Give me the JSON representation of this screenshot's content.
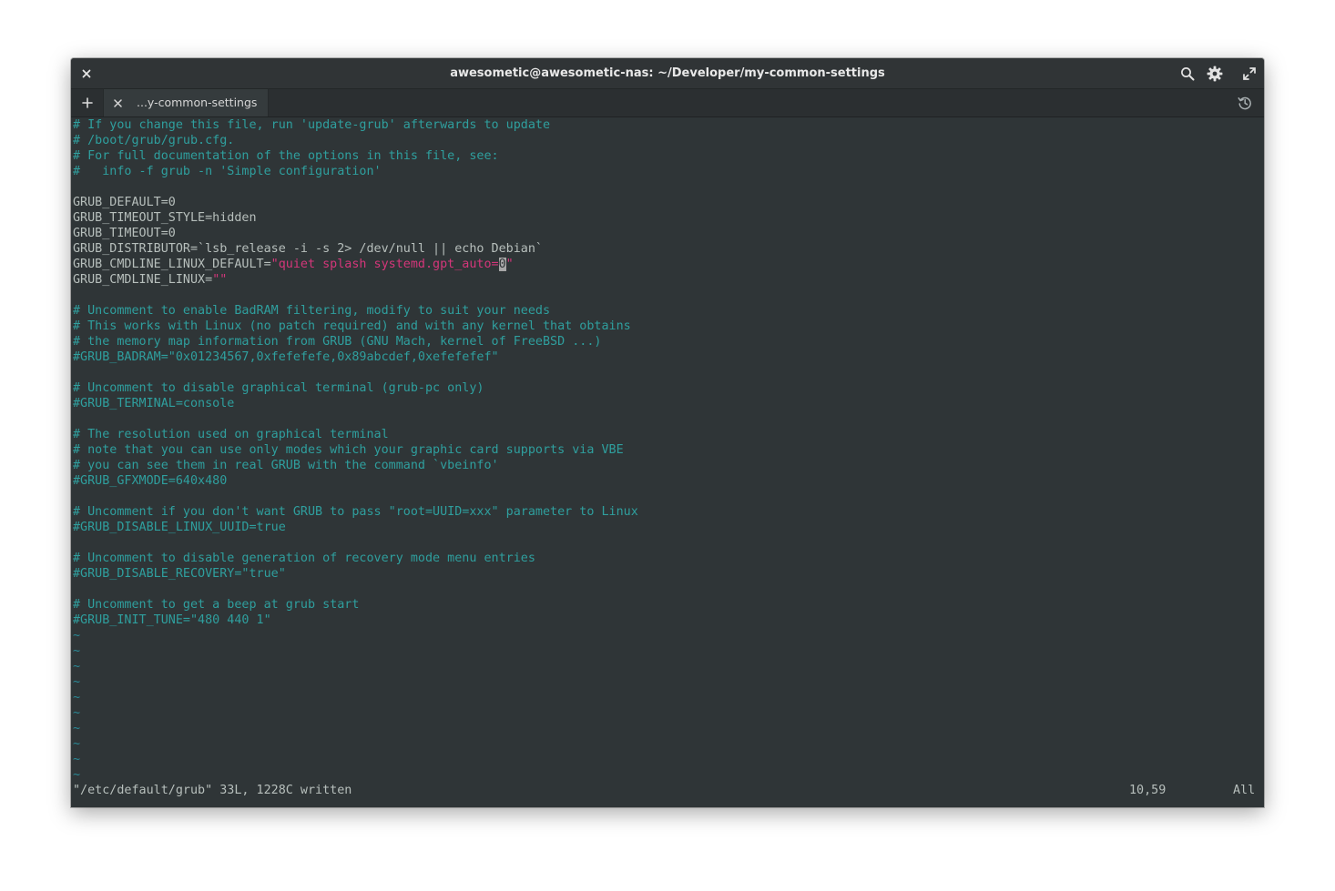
{
  "window": {
    "title": "awesometic@awesometic-nas: ~/Developer/my-common-settings"
  },
  "tabs": [
    {
      "label": "...y-common-settings"
    }
  ],
  "editor": {
    "lines": [
      "# If you change this file, run 'update-grub' afterwards to update",
      "# /boot/grub/grub.cfg.",
      "# For full documentation of the options in this file, see:",
      "#   info -f grub -n 'Simple configuration'",
      "",
      "GRUB_DEFAULT=0",
      "GRUB_TIMEOUT_STYLE=hidden",
      "GRUB_TIMEOUT=0",
      "GRUB_DISTRIBUTOR=`lsb_release -i -s 2> /dev/null || echo Debian`",
      "GRUB_CMDLINE_LINUX_DEFAULT=\"quiet splash systemd.gpt_auto=0\"",
      "GRUB_CMDLINE_LINUX=\"\"",
      "",
      "# Uncomment to enable BadRAM filtering, modify to suit your needs",
      "# This works with Linux (no patch required) and with any kernel that obtains",
      "# the memory map information from GRUB (GNU Mach, kernel of FreeBSD ...)",
      "#GRUB_BADRAM=\"0x01234567,0xfefefefe,0x89abcdef,0xefefefef\"",
      "",
      "# Uncomment to disable graphical terminal (grub-pc only)",
      "#GRUB_TERMINAL=console",
      "",
      "# The resolution used on graphical terminal",
      "# note that you can use only modes which your graphic card supports via VBE",
      "# you can see them in real GRUB with the command `vbeinfo'",
      "#GRUB_GFXMODE=640x480",
      "",
      "# Uncomment if you don't want GRUB to pass \"root=UUID=xxx\" parameter to Linux",
      "#GRUB_DISABLE_LINUX_UUID=true",
      "",
      "# Uncomment to disable generation of recovery mode menu entries",
      "#GRUB_DISABLE_RECOVERY=\"true\"",
      "",
      "# Uncomment to get a beep at grub start",
      "#GRUB_INIT_TUNE=\"480 440 1\""
    ],
    "tilde": "~",
    "tilde_count": 10,
    "cmdline_value": {
      "key": "GRUB_CMDLINE_LINUX_DEFAULT=",
      "quote_open": "\"",
      "string_text": "quiet splash systemd.gpt_auto=",
      "cursor_char": "0",
      "quote_close": "\""
    },
    "cmdline_linux": {
      "key": "GRUB_CMDLINE_LINUX=",
      "value": "\"\""
    },
    "status_message": "\"/etc/default/grub\" 33L, 1228C written",
    "cursor_position": "10,59",
    "scroll_position": "All"
  }
}
